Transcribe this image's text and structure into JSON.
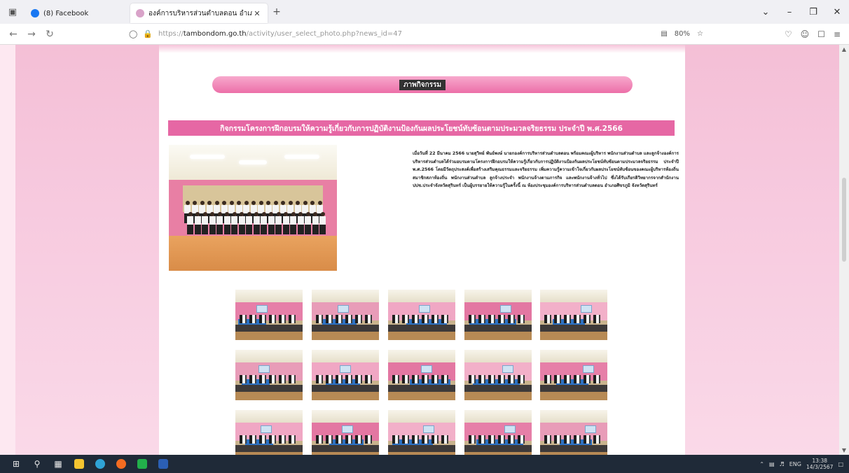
{
  "browser": {
    "tabs": [
      {
        "title": "(8) Facebook",
        "active": false,
        "favicon": "facebook-icon"
      },
      {
        "title": "องค์การบริหารส่วนตำบลดอน อำเภอด้า...",
        "active": true,
        "favicon": "site-icon"
      }
    ],
    "new_tab_label": "+",
    "address": {
      "prefix": "https://",
      "host": "tambondom.go.th",
      "path": "/activity/user_select_photo.php?news_id=47"
    },
    "zoom": "80%",
    "accent_color": "#e667a4"
  },
  "page": {
    "header_label": "ภาพกิจกรรม",
    "title": "กิจกรรมโครงการฝึกอบรมให้ความรู้เกี่ยวกับการปฏิบัติงานป้องกันผลประโยชน์ทับซ้อนตามประมวลจริยธรรม ประจำปี พ.ศ.2566",
    "description": "เมื่อวันที่ 22 มีนาคม 2566 นายสุวิทย์ พันธ์พงษ์ นายกองค์การบริหารส่วนตำบลดอน พร้อมคณะผู้บริหาร พนักงานส่วนตำบล และลูกจ้างองค์การบริหารส่วนตำบลได้ร่วมอบรมตามโครงการฝึกอบรมให้ความรู้เกี่ยวกับการปฏิบัติงานป้องกันผลประโยชน์ทับซ้อนตามประมวลจริยธรรม ประจำปี พ.ศ.2566 โดยมีวัตถุประสงค์เพื่อสร้างเสริมคุณธรรมและจริยธรรม เพิ่มความรู้ความเข้าใจเกี่ยวกับผลประโยชน์ทับซ้อนของคณะผู้บริหารท้องถิ่น สมาชิกสภาท้องถิ่น พนักงานส่วนตำบล ลูกจ้างประจำ พนักงานจ้างตามภารกิจ และพนักงานจ้างทั่วไป ซึ่งได้รับเกียรติวิทยากรจากสำนักงาน ปปช.ประจำจังหวัดสุรินทร์ เป็นผู้บรรยายให้ความรู้ในครั้งนี้ ณ ห้องประชุมองค์การบริหารส่วนตำบลดอน อำเภอศีขรภูมิ จังหวัดสุรินทร์"
  },
  "taskbar": {
    "language": "ENG",
    "time": "13:38",
    "date": "14/3/2567"
  }
}
